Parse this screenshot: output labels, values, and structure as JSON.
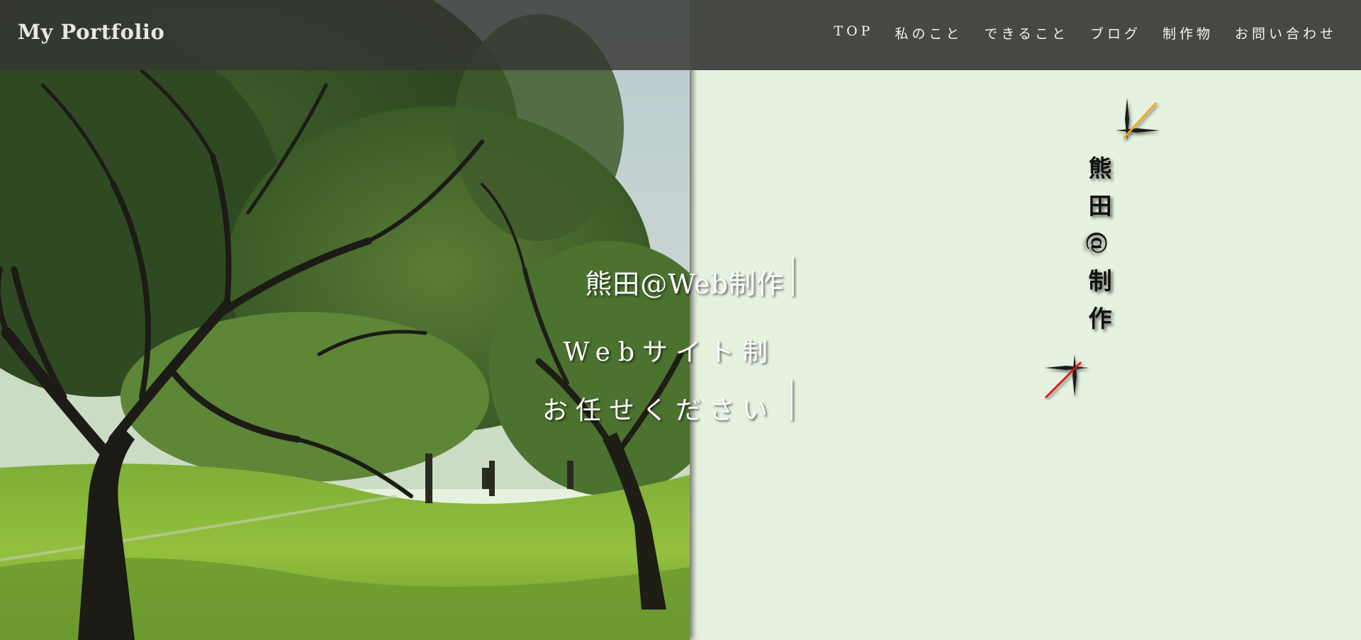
{
  "header": {
    "logo": "My Portfolio",
    "nav": [
      {
        "label": "TOP"
      },
      {
        "label": "私のこと"
      },
      {
        "label": "できること"
      },
      {
        "label": "ブログ"
      },
      {
        "label": "制作物"
      },
      {
        "label": "お問い合わせ"
      }
    ]
  },
  "hero": {
    "line1": "熊田@Web制作",
    "line2": "Webサイト制",
    "line3": "お任せください",
    "vertical_title": "熊田@制作"
  },
  "colors": {
    "right_background": "#e6f2e0",
    "header_background": "#464843",
    "accent_orange": "#f2a51e",
    "accent_red": "#e01818"
  },
  "icons": {
    "top_cross": "orange-slash-cross-icon",
    "bottom_cross": "red-slash-cross-icon"
  }
}
